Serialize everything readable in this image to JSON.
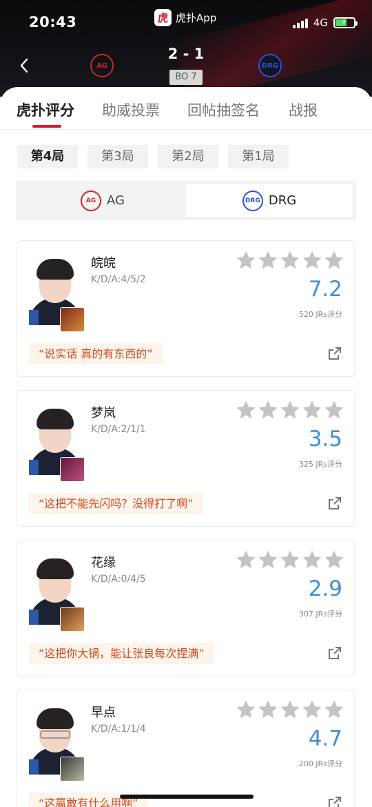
{
  "status_bar": {
    "time": "20:43",
    "app_name": "虎扑App",
    "app_logo_char": "虎",
    "network": "4G"
  },
  "match": {
    "score": "2 - 1",
    "format": "BO 7",
    "team_a_logo_text": "AG",
    "team_b_logo_text": "DRG"
  },
  "tabs": [
    {
      "label": "虎扑评分",
      "active": true
    },
    {
      "label": "助威投票",
      "active": false
    },
    {
      "label": "回帖抽签名",
      "active": false
    },
    {
      "label": "战报",
      "active": false
    }
  ],
  "rounds": [
    {
      "label": "第4局",
      "active": true
    },
    {
      "label": "第3局",
      "active": false
    },
    {
      "label": "第2局",
      "active": false
    },
    {
      "label": "第1局",
      "active": false
    }
  ],
  "team_switch": {
    "team_a": {
      "name": "AG",
      "logo_text": "AG"
    },
    "team_b": {
      "name": "DRG",
      "logo_text": "DRG"
    },
    "selected": "DRG"
  },
  "players": [
    {
      "name": "皖皖",
      "kda": "K/D/A:4/5/2",
      "score": "7.2",
      "votes": "520 JRs评分",
      "quote": "“说实话 真的有东西的”",
      "hero_colors": [
        "#7a2a18",
        "#d98a3a"
      ],
      "glasses": false
    },
    {
      "name": "梦岚",
      "kda": "K/D/A:2/1/1",
      "score": "3.5",
      "votes": "325 JRs评分",
      "quote": "“这把不能先闪吗？没得打了啊”",
      "hero_colors": [
        "#5a1a3a",
        "#c0507a"
      ],
      "glasses": false
    },
    {
      "name": "花缘",
      "kda": "K/D/A:0/4/5",
      "score": "2.9",
      "votes": "307 JRs评分",
      "quote": "“这把你大锅，能让张良每次捏满”",
      "hero_colors": [
        "#6a3a1a",
        "#e0a060"
      ],
      "glasses": false
    },
    {
      "name": "早点",
      "kda": "K/D/A:1/1/4",
      "score": "4.7",
      "votes": "200 JRs评分",
      "quote": "“这赢敢有什么用啊”",
      "hero_colors": [
        "#3a3a3a",
        "#b8b8a0"
      ],
      "glasses": true
    }
  ],
  "colors": {
    "accent_red": "#d0202c",
    "score_blue": "#3f8fd6",
    "quote_text": "#d04a20",
    "quote_bg": "#fdf4ec",
    "star_gray": "#c4c4c8"
  }
}
